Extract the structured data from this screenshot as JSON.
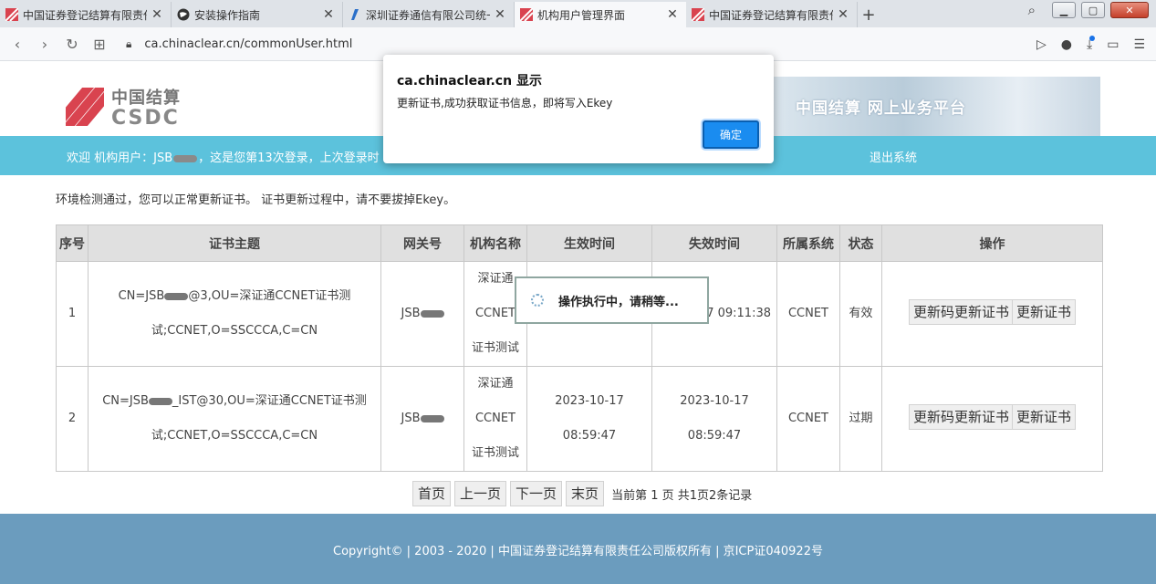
{
  "browser": {
    "tabs": [
      {
        "label": "中国证券登记结算有限责任",
        "icon": "csdc-favicon",
        "active": false
      },
      {
        "label": "安装操作指南",
        "icon": "globe-favicon",
        "active": false
      },
      {
        "label": "深圳证券通信有限公司统一",
        "icon": "sscc-favicon",
        "active": false
      },
      {
        "label": "机构用户管理界面",
        "icon": "csdc-favicon",
        "active": true
      },
      {
        "label": "中国证券登记结算有限责任",
        "icon": "csdc-favicon",
        "active": false
      }
    ],
    "url": "ca.chinaclear.cn/commonUser.html"
  },
  "header": {
    "logo_cn": "中国结算",
    "logo_en": "CSDC",
    "banner_text": "中国结算 网上业务平台"
  },
  "welcome": {
    "text_before_mask": "欢迎 机构用户：JSB",
    "text_after_mask": "，这是您第13次登录，上次登录时",
    "logout": "退出系统"
  },
  "notice": "环境检测通过，您可以正常更新证书。 证书更新过程中，请不要拔掉Ekey。",
  "table": {
    "headers": [
      "序号",
      "证书主题",
      "网关号",
      "机构名称",
      "生效时间",
      "失效时间",
      "所属系统",
      "状态",
      "操作"
    ],
    "rows": [
      {
        "index": "1",
        "subject_a": "CN=JSB",
        "subject_b": "@3,OU=深证通CCNET证书测试;CCNET,O=SSCCCA,C=CN",
        "gateway": "JSB",
        "org": "深证通CCNET证书测试",
        "start": "",
        "end": "17 09:11:38",
        "system": "CCNET",
        "status": "有效",
        "btn1": "更新码更新证书",
        "btn2": "更新证书"
      },
      {
        "index": "2",
        "subject_a": "CN=JSB",
        "subject_b": "_IST@30,OU=深证通CCNET证书测试;CCNET,O=SSCCCA,C=CN",
        "gateway": "JSB",
        "org": "深证通CCNET证书测试",
        "start": "2023-10-17 08:59:47",
        "end": "2023-10-17 08:59:47",
        "system": "CCNET",
        "status": "过期",
        "btn1": "更新码更新证书",
        "btn2": "更新证书"
      }
    ]
  },
  "pager": {
    "first": "首页",
    "prev": "上一页",
    "next": "下一页",
    "last": "末页",
    "info": "当前第 1 页 共1页2条记录"
  },
  "footer": "Copyright© | 2003 - 2020 | 中国证券登记结算有限责任公司版权所有 | 京ICP证040922号",
  "loading": "操作执行中，请稍等...",
  "dialog": {
    "title": "ca.chinaclear.cn 显示",
    "message": "更新证书,成功获取证书信息，即将写入Ekey",
    "ok": "确定"
  },
  "colors": {
    "welcome_bar": "#5cc2dc",
    "footer": "#6b9cbe",
    "brand_red": "#d9434f",
    "ok_button": "#1a8cf0"
  }
}
